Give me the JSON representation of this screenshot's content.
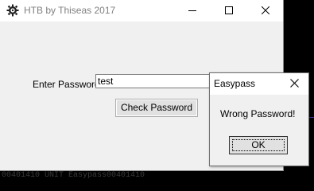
{
  "main_window": {
    "title": "HTB by Thiseas 2017",
    "icon": "app-gear-icon",
    "controls": {
      "minimize_icon": "minimize-icon",
      "maximize_icon": "maximize-icon",
      "close_icon": "close-icon"
    },
    "form": {
      "password_label": "Enter Password",
      "password_value": "test",
      "check_button_label": "Check Password"
    }
  },
  "dialog": {
    "title": "Easypass",
    "message": "Wrong Password!",
    "ok_label": "OK",
    "close_icon": "close-icon"
  },
  "background": {
    "partial_text": "00401410 UNIT Easypass00401410"
  },
  "colors": {
    "window_bg": "#f0f0f0",
    "titlebar_bg": "#ffffff",
    "title_text": "#808080",
    "desktop_bg": "#000000",
    "button_face": "#e1e1e1"
  }
}
